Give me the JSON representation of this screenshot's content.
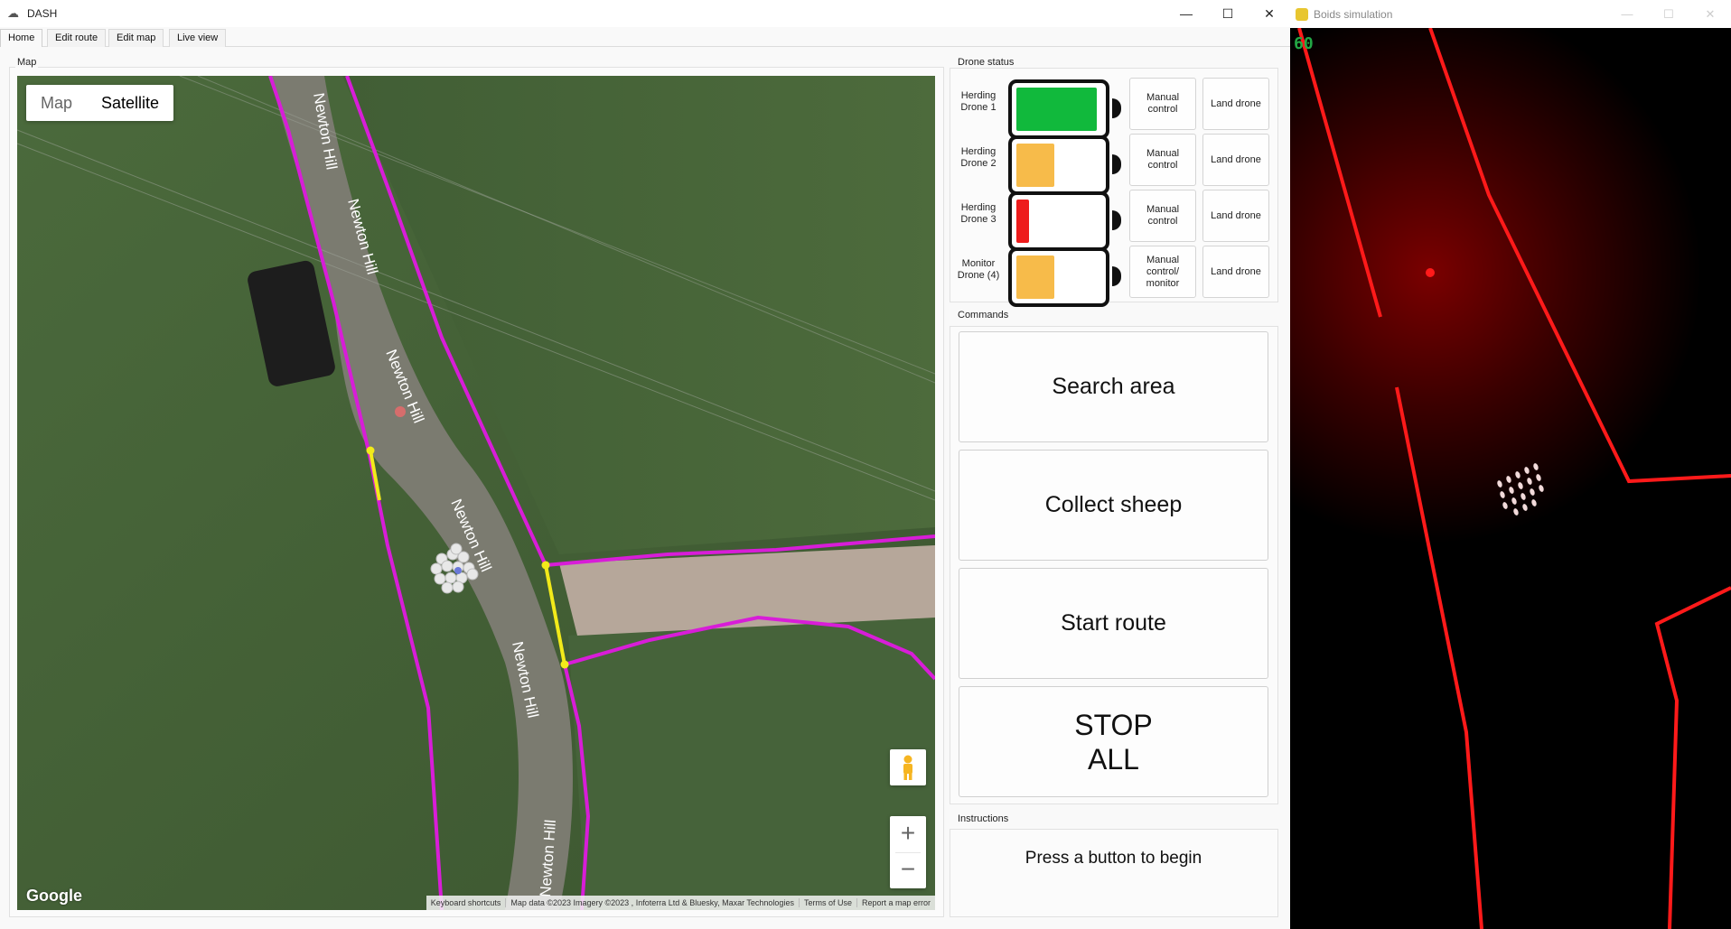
{
  "window": {
    "title": "DASH",
    "minimize": "—",
    "maximize": "☐",
    "close": "✕"
  },
  "tabs": [
    {
      "label": "Home"
    },
    {
      "label": "Edit route"
    },
    {
      "label": "Edit map"
    },
    {
      "label": "Live view"
    }
  ],
  "map": {
    "group_label": "Map",
    "type_map": "Map",
    "type_satellite": "Satellite",
    "road_label": "Newton Hill",
    "google": "Google",
    "zoom_in": "+",
    "zoom_out": "−",
    "attribution": [
      "Keyboard shortcuts",
      "Map data ©2023 Imagery ©2023 , Infoterra Ltd & Bluesky, Maxar Technologies",
      "Terms of Use",
      "Report a map error"
    ],
    "colors": {
      "route": "#d81dd8",
      "gate": "#f2ea1a",
      "field": "#3f5a34"
    }
  },
  "drone_status": {
    "group_label": "Drone status",
    "drones": [
      {
        "name": "Herding Drone 1",
        "battery_level": 0.95,
        "battery_color": "#11b93c",
        "manual_label": "Manual control",
        "land_label": "Land drone"
      },
      {
        "name": "Herding Drone 2",
        "battery_level": 0.45,
        "battery_color": "#f7bb4a",
        "manual_label": "Manual control",
        "land_label": "Land drone"
      },
      {
        "name": "Herding Drone 3",
        "battery_level": 0.15,
        "battery_color": "#ee1c1c",
        "manual_label": "Manual control",
        "land_label": "Land drone"
      },
      {
        "name": "Monitor Drone (4)",
        "battery_level": 0.45,
        "battery_color": "#f7bb4a",
        "manual_label": "Manual control/ monitor",
        "land_label": "Land drone"
      }
    ]
  },
  "commands": {
    "group_label": "Commands",
    "search": "Search area",
    "collect": "Collect sheep",
    "route": "Start route",
    "stop": "STOP\nALL"
  },
  "instructions": {
    "group_label": "Instructions",
    "text": "Press a button to begin"
  },
  "boids": {
    "title": "Boids simulation",
    "fps": "60",
    "minimize": "—",
    "maximize": "☐",
    "close": "✕",
    "colors": {
      "wall": "#ff1a1a",
      "glow": "#7a0000",
      "sheep": "#f2dada"
    }
  }
}
